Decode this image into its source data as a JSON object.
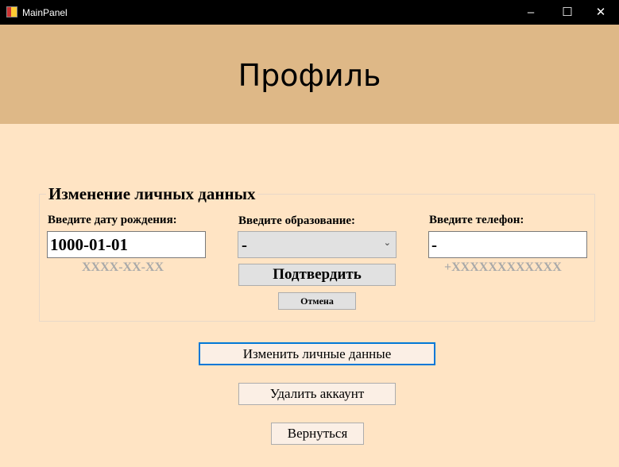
{
  "window": {
    "title": "MainPanel",
    "minimize": "–",
    "maximize": "☐",
    "close": "✕"
  },
  "header": {
    "title": "Профиль"
  },
  "group": {
    "title": "Изменение личных данных",
    "birth_label": "Введите дату рождения:",
    "birth_value": "1000-01-01",
    "birth_hint": "XXXX-XX-XX",
    "edu_label": "Введите образование:",
    "edu_value": "-",
    "phone_label": "Введите телефон:",
    "phone_value": "-",
    "phone_hint": "+XXXXXXXXXXXX",
    "confirm": "Подтвердить",
    "cancel": "Отмена"
  },
  "actions": {
    "edit": "Изменить личные данные",
    "delete": "Удалить аккаунт",
    "back": "Вернуться"
  }
}
